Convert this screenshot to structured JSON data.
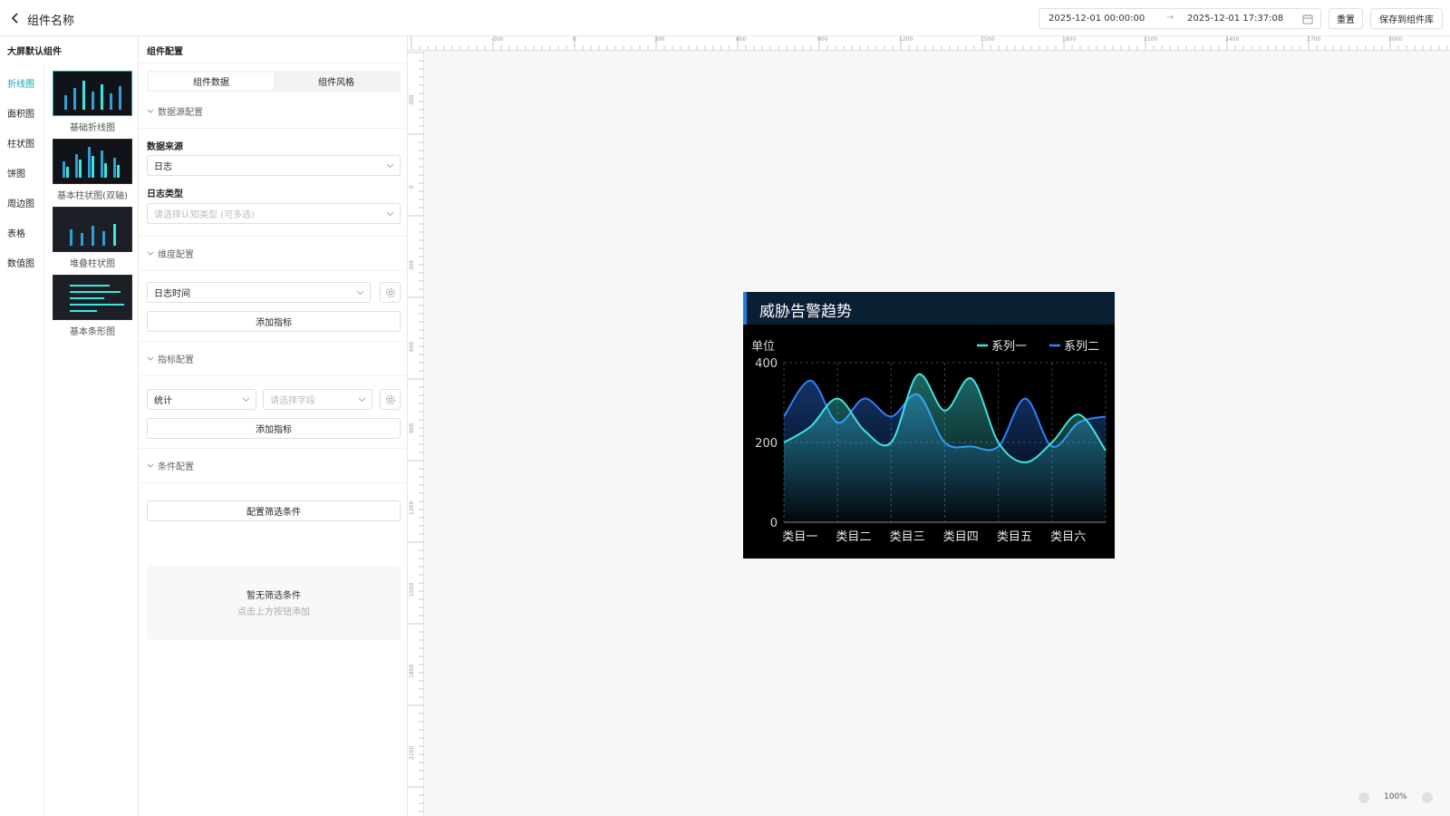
{
  "header": {
    "title": "组件名称",
    "date_start": "2025-12-01 00:00:00",
    "date_separator": "→",
    "date_end": "2025-12-01 17:37:08",
    "reset_label": "重置",
    "save_label": "保存到组件库"
  },
  "library": {
    "title": "大屏默认组件",
    "categories": [
      "折线图",
      "面积图",
      "柱状图",
      "饼图",
      "周边图",
      "表格",
      "数值图"
    ],
    "active_category": "折线图",
    "thumbnails": [
      "基础折线图",
      "基本柱状图(双轴)",
      "堆叠柱状图",
      "基本条形图"
    ]
  },
  "config": {
    "title": "组件配置",
    "tabs": [
      "组件数据",
      "组件风格"
    ],
    "active_tab": "组件数据",
    "datasource_section": "数据源配置",
    "datasource_label": "数据来源",
    "datasource_value": "日志",
    "logtype_label": "日志类型",
    "logtype_placeholder": "请选择认知类型 (可多选)",
    "dimension_section": "维度配置",
    "dimension_value": "日志时间",
    "add_metric_label": "添加指标",
    "metric_section": "指标配置",
    "metric_agg_value": "统计",
    "metric_field_placeholder": "请选择字段",
    "add_metric_label_2": "添加指标",
    "condition_section": "条件配置",
    "filter_button_label": "配置筛选条件",
    "empty_title": "暂无筛选条件",
    "empty_subtitle": "点击上方按钮添加"
  },
  "ruler": {
    "h_labels": [
      "-300",
      "0",
      "300",
      "600",
      "900",
      "1200",
      "1500",
      "1800",
      "2100",
      "2400",
      "2700",
      "3000"
    ],
    "v_labels": [
      "-300",
      "0",
      "300",
      "600",
      "900",
      "1200",
      "1500",
      "1800",
      "2100"
    ]
  },
  "widget": {
    "title": "威胁告警趋势",
    "accent_color": "#1e7fe0",
    "header_bg": "#0b1f33"
  },
  "chart_data": {
    "type": "area",
    "title": "威胁告警趋势",
    "ylabel": "单位",
    "categories": [
      "类目一",
      "类目二",
      "类目三",
      "类目四",
      "类目五",
      "类目六"
    ],
    "ylim": [
      0,
      400
    ],
    "yticks": [
      0,
      200,
      400
    ],
    "x": [
      0,
      0.5,
      1,
      1.5,
      2,
      2.5,
      3,
      3.5,
      4,
      4.5,
      5,
      5.5,
      6
    ],
    "series": [
      {
        "name": "系列一",
        "color": "#3ee6e0",
        "values": [
          200,
          240,
          310,
          230,
          200,
          370,
          280,
          360,
          200,
          150,
          200,
          270,
          180
        ]
      },
      {
        "name": "系列二",
        "color": "#2f80ff",
        "values": [
          265,
          355,
          250,
          310,
          265,
          320,
          200,
          190,
          190,
          310,
          190,
          250,
          265
        ]
      }
    ],
    "legend_position": "top-right",
    "grid": true
  },
  "zoom": {
    "level": "100%"
  }
}
